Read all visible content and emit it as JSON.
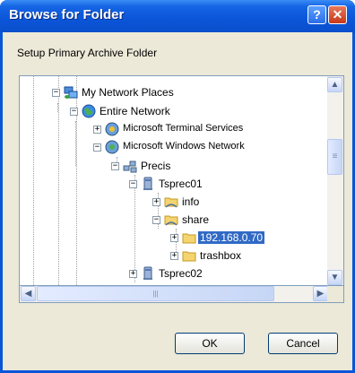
{
  "window": {
    "title": "Browse for Folder",
    "help_label": "?",
    "close_label": "✕"
  },
  "instruction": "Setup Primary Archive Folder",
  "tree": {
    "items": [
      {
        "label": "My Network Places",
        "icon": "network-places-icon",
        "expander": "−"
      },
      {
        "label": "Entire Network",
        "icon": "globe-icon",
        "expander": "−"
      },
      {
        "label": "Microsoft Terminal Services",
        "icon": "terminal-services-icon",
        "expander": "+"
      },
      {
        "label": "Microsoft Windows Network",
        "icon": "windows-network-icon",
        "expander": "−"
      },
      {
        "label": "Precis",
        "icon": "workgroup-icon",
        "expander": "−"
      },
      {
        "label": "Tsprec01",
        "icon": "computer-icon",
        "expander": "−"
      },
      {
        "label": "info",
        "icon": "shared-folder-icon",
        "expander": "+"
      },
      {
        "label": "share",
        "icon": "shared-folder-icon",
        "expander": "−"
      },
      {
        "label": "192.168.0.70",
        "icon": "folder-icon",
        "expander": "+",
        "selected": true
      },
      {
        "label": "trashbox",
        "icon": "folder-icon",
        "expander": "+"
      },
      {
        "label": "Tsprec02",
        "icon": "computer-icon",
        "expander": "+"
      }
    ]
  },
  "scrollbars": {
    "up": "▲",
    "down": "▼",
    "left": "◀",
    "right": "▶",
    "grip": "≡",
    "hgrip": "|||"
  },
  "buttons": {
    "ok": "OK",
    "cancel": "Cancel"
  }
}
